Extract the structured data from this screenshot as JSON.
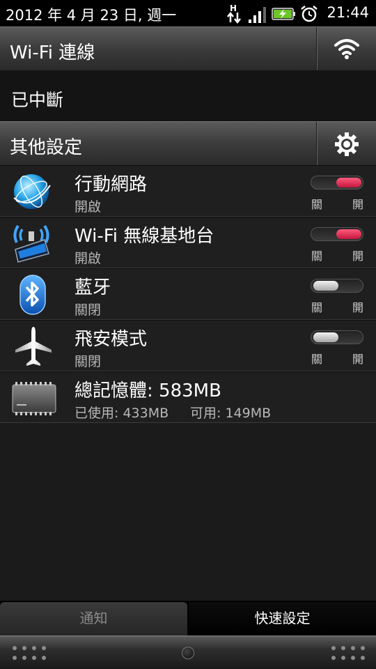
{
  "status_bar": {
    "date": "2012 年 4 月 23 日, 週一",
    "time": "21:44",
    "network_type": "H",
    "icons": [
      "data-transfer-icon",
      "signal-icon",
      "battery-charging-icon",
      "alarm-icon"
    ]
  },
  "wifi_section": {
    "title": "Wi-Fi 連線",
    "icon": "wifi-icon",
    "status": "已中斷"
  },
  "other_section": {
    "title": "其他設定",
    "icon": "gear-icon"
  },
  "toggle_labels": {
    "off": "關",
    "on": "開"
  },
  "rows": [
    {
      "title": "行動網路",
      "subtitle": "開啟",
      "icon": "globe-icon",
      "state": "on"
    },
    {
      "title": "Wi-Fi 無線基地台",
      "subtitle": "開啟",
      "icon": "hotspot-icon",
      "state": "on"
    },
    {
      "title": "藍牙",
      "subtitle": "關閉",
      "icon": "bluetooth-icon",
      "state": "off"
    },
    {
      "title": "飛安模式",
      "subtitle": "關閉",
      "icon": "airplane-icon",
      "state": "off"
    }
  ],
  "memory": {
    "title": "總記憶體: 583MB",
    "used": "已使用: 433MB",
    "available": "可用: 149MB",
    "icon": "memory-chip-icon"
  },
  "tabs": {
    "notifications": "通知",
    "quick_settings": "快速設定",
    "active": "quick_settings"
  },
  "colors": {
    "toggle_on": "#d91f47",
    "toggle_off": "#d0d0d0",
    "header_gradient_top": "#5a5a5a",
    "background": "#1b1b1b"
  }
}
